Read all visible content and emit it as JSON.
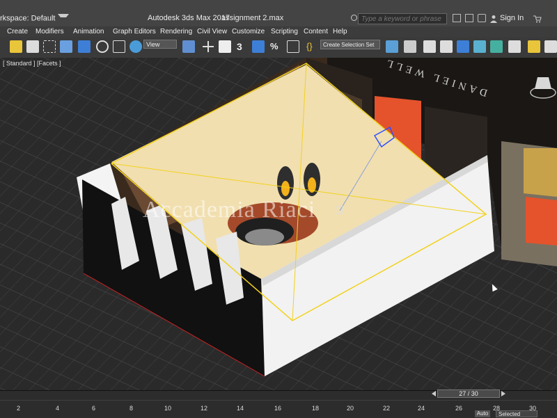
{
  "titlebar": {
    "workspace": "rkspace: Default",
    "app_title": "Autodesk 3ds Max 2017",
    "file_title": "assignment 2.max",
    "search_placeholder": "Type a keyword or phrase",
    "signin": "Sign In"
  },
  "menu": [
    {
      "label": "Create"
    },
    {
      "label": "Modifiers"
    },
    {
      "label": "Animation"
    },
    {
      "label": "Graph Editors"
    },
    {
      "label": "Rendering"
    },
    {
      "label": "Civil View"
    },
    {
      "label": "Customize"
    },
    {
      "label": "Scripting"
    },
    {
      "label": "Content"
    },
    {
      "label": "Help"
    }
  ],
  "toolbar": {
    "view_dropdown": "View",
    "selection_set": "Create Selection Set"
  },
  "viewport": {
    "label": "[ Standard ] [Facets ]",
    "sign_text": "DANIEL WELL",
    "watermark": "Accademia Riaci"
  },
  "timeline": {
    "frame_display": "27 / 30",
    "tick_labels": [
      "2",
      "4",
      "6",
      "8",
      "10",
      "12",
      "14",
      "16",
      "18",
      "20",
      "22",
      "24",
      "26",
      "28",
      "30"
    ],
    "auto_label": "Auto",
    "selected_label": "Selected"
  },
  "colors": {
    "accent_blue": "#3d7fd6",
    "wall_orange": "#e4532c",
    "selection_yellow": "#f2d21b",
    "floor_cream": "#f1dfb0"
  }
}
